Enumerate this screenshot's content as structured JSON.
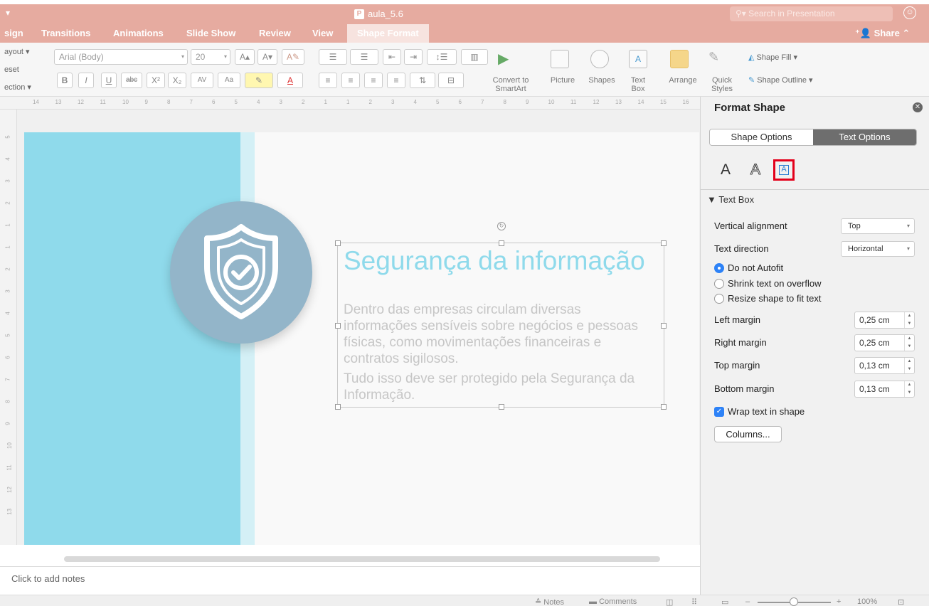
{
  "window": {
    "title": "aula_5.6",
    "search_placeholder": "Search in Presentation"
  },
  "tabs": [
    {
      "label": "sign"
    },
    {
      "label": "Transitions"
    },
    {
      "label": "Animations"
    },
    {
      "label": "Slide Show"
    },
    {
      "label": "Review"
    },
    {
      "label": "View"
    },
    {
      "label": "Shape Format"
    }
  ],
  "share_label": "Share",
  "ribbon": {
    "layout_label": "ayout",
    "reset_label": "eset",
    "section_label": "ection",
    "font_name": "Arial (Body)",
    "font_size": "20",
    "bold": "B",
    "italic": "I",
    "underline": "U",
    "strike": "abc",
    "superscript": "X²",
    "subscript": "X₂",
    "char_spacing": "AV",
    "change_case": "Aa",
    "grow_font": "A▴",
    "shrink_font": "A▾",
    "font_color_glyph": "A",
    "convert_smartart_line1": "Convert to",
    "convert_smartart_line2": "SmartArt",
    "picture": "Picture",
    "shapes": "Shapes",
    "textbox_line1": "Text",
    "textbox_line2": "Box",
    "arrange": "Arrange",
    "quick_styles_line1": "Quick",
    "quick_styles_line2": "Styles",
    "shape_fill": "Shape Fill",
    "shape_outline": "Shape Outline"
  },
  "ruler_numbers": [
    "14",
    "13",
    "12",
    "11",
    "10",
    "9",
    "8",
    "7",
    "6",
    "5",
    "4",
    "3",
    "2",
    "1",
    "1",
    "2",
    "3",
    "4",
    "5",
    "6",
    "7",
    "8",
    "9",
    "10",
    "11",
    "12",
    "13",
    "14",
    "15",
    "16"
  ],
  "vruler_numbers": [
    "5",
    "4",
    "3",
    "2",
    "1",
    "1",
    "2",
    "3",
    "4",
    "5",
    "6",
    "7",
    "8",
    "9",
    "10",
    "11",
    "12",
    "13"
  ],
  "slide": {
    "title": "Segurança da informação",
    "body_paragraph_1": "Dentro das empresas circulam diversas informações sensíveis sobre negócios e pessoas físicas, como movimentações financeiras e contratos sigilosos.",
    "body_paragraph_2": "Tudo isso deve ser protegido pela Segurança da Informação.",
    "colors": {
      "band": "#8fdaeb",
      "badge": "#93b5c9",
      "title": "#8fdaeb",
      "body": "#c6c6c6"
    }
  },
  "notes_placeholder": "Click to add notes",
  "statusbar": {
    "notes": "Notes",
    "comments": "Comments",
    "zoom": "100%"
  },
  "panel": {
    "title": "Format Shape",
    "tab_shape_options": "Shape Options",
    "tab_text_options": "Text Options",
    "icon_text_fill": "A",
    "icon_text_effects": "A",
    "icon_text_box": "A",
    "section_title": "Text Box",
    "vertical_alignment_label": "Vertical alignment",
    "vertical_alignment_value": "Top",
    "text_direction_label": "Text direction",
    "text_direction_value": "Horizontal",
    "autofit_options": [
      {
        "label": "Do not Autofit",
        "selected": true
      },
      {
        "label": "Shrink text on overflow",
        "selected": false
      },
      {
        "label": "Resize shape to fit text",
        "selected": false
      }
    ],
    "left_margin_label": "Left margin",
    "left_margin_value": "0,25 cm",
    "right_margin_label": "Right margin",
    "right_margin_value": "0,25 cm",
    "top_margin_label": "Top margin",
    "top_margin_value": "0,13 cm",
    "bottom_margin_label": "Bottom margin",
    "bottom_margin_value": "0,13 cm",
    "wrap_text_label": "Wrap text in shape",
    "wrap_text_checked": true,
    "columns_button": "Columns..."
  },
  "accent_color": "#e6aba0"
}
